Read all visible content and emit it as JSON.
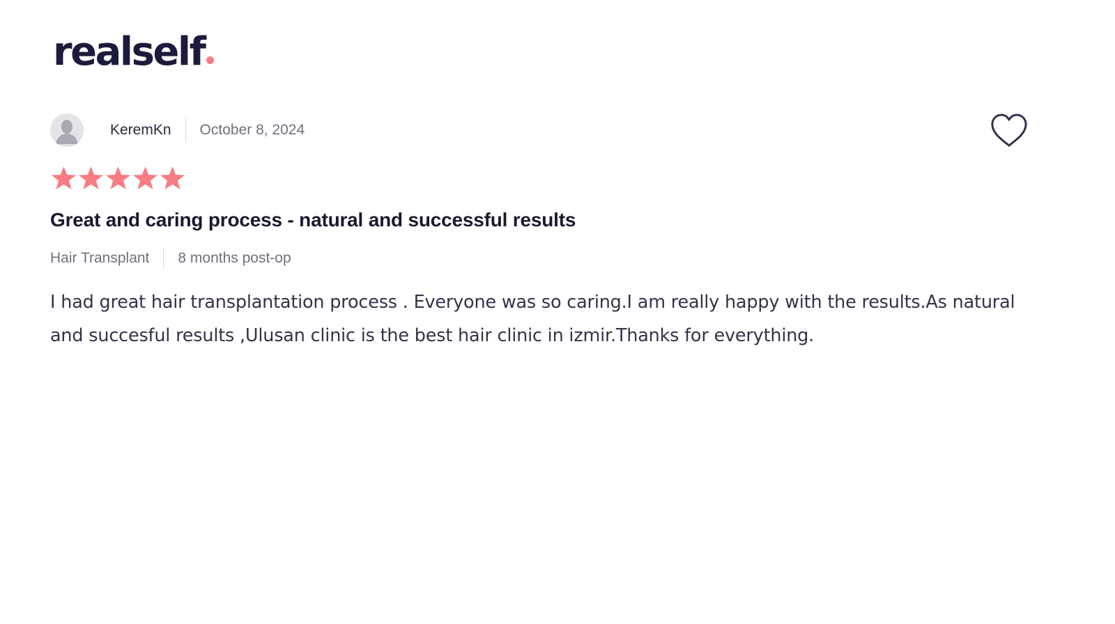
{
  "brand": {
    "logo_text": "realself",
    "accent_color": "#f87c83",
    "text_color": "#1d1b3c"
  },
  "review": {
    "author": "KeremKn",
    "date": "October 8, 2024",
    "rating": 5,
    "rating_max": 5,
    "star_color": "#f87c83",
    "title": "Great and caring process - natural and successful results",
    "procedure": "Hair Transplant",
    "time_post_op": "8 months post-op",
    "body": "I had great hair transplantation process . Everyone was so caring.I am really happy with the results.As natural and succesful results ,Ulusan clinic is the best hair clinic in izmir.Thanks for everything.",
    "icons": {
      "avatar": "user-avatar-icon",
      "favorite": "heart-icon",
      "rating": "star-icon"
    }
  }
}
